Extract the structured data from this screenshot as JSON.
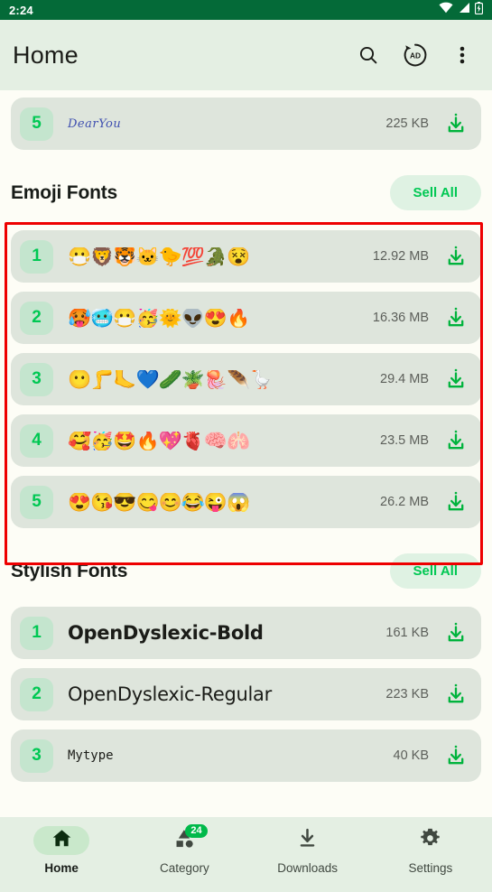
{
  "status_bar": {
    "clock": "2:24",
    "icons": [
      "wifi-icon",
      "signal-icon",
      "battery-charging-icon"
    ],
    "background": "#046a38"
  },
  "app_bar": {
    "title": "Home",
    "actions": [
      "search-icon",
      "ad-icon",
      "overflow-menu-icon"
    ],
    "background": "#e4efe3"
  },
  "theme": {
    "page_background": "#fdfdf6",
    "row_background": "#dee5dc",
    "badge_background": "#c4e5ce",
    "accent_green": "#00c853",
    "highlight_red": "#ee0000"
  },
  "partial_top_row": {
    "index": "5",
    "name": "DearYou",
    "size": "225 KB",
    "action": "download-icon"
  },
  "sections": [
    {
      "title": "Emoji Fonts",
      "sell_all_label": "Sell All",
      "highlighted": true,
      "items": [
        {
          "index": "1",
          "name": "😷🦁🐯🐱🐤💯🐊😵",
          "size": "12.92 MB",
          "action": "download-icon"
        },
        {
          "index": "2",
          "name": "🥵🥶😷🥳🌞👽😍🔥",
          "size": "16.36 MB",
          "action": "download-icon"
        },
        {
          "index": "3",
          "name": "😶🦵🦶💙🥒🪴🪼🪶🪿",
          "size": "29.4 MB",
          "action": "download-icon"
        },
        {
          "index": "4",
          "name": "🥰🥳🤩🔥💖🫀🧠🫁",
          "size": "23.5 MB",
          "action": "download-icon"
        },
        {
          "index": "5",
          "name": "😍😘😎😋😊😂😜😱",
          "size": "26.2 MB",
          "action": "download-icon"
        }
      ]
    },
    {
      "title": "Stylish Fonts",
      "sell_all_label": "Sell All",
      "highlighted": false,
      "items": [
        {
          "index": "1",
          "name": "OpenDyslexic-Bold",
          "size": "161 KB",
          "action": "download-icon"
        },
        {
          "index": "2",
          "name": "OpenDyslexic-Regular",
          "size": "223 KB",
          "action": "download-icon"
        },
        {
          "index": "3",
          "name": "Mytype",
          "size": "40 KB",
          "action": "download-icon"
        }
      ]
    }
  ],
  "bottom_nav": {
    "items": [
      {
        "label": "Home",
        "icon": "home-icon",
        "active": true,
        "badge": null
      },
      {
        "label": "Category",
        "icon": "category-icon",
        "active": false,
        "badge": "24"
      },
      {
        "label": "Downloads",
        "icon": "download-icon",
        "active": false,
        "badge": null
      },
      {
        "label": "Settings",
        "icon": "gear-icon",
        "active": false,
        "badge": null
      }
    ]
  }
}
